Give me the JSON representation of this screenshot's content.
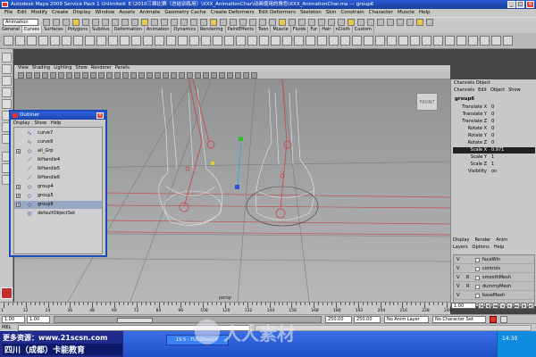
{
  "window": {
    "title": "Autodesk Maya 2009 Service Pack 1  Unlimited: E:\\2010三维比赛（总结训练用）\\XXX_AnimationChar\\动画使用的角色\\XXX_AnimationChar.ma  ---  group6",
    "min": "_",
    "max": "□",
    "close": "×"
  },
  "menubar": [
    "File",
    "Edit",
    "Modify",
    "Create",
    "Display",
    "Window",
    "Assets",
    "Animate",
    "Geometry Cache",
    "Create Deformers",
    "Edit Deformers",
    "Skeleton",
    "Skin",
    "Constrain",
    "Character",
    "Muscle",
    "Help"
  ],
  "statusline": {
    "mode": "Animation"
  },
  "shelf_tabs": [
    "General",
    "Curves",
    "Surfaces",
    "Polygons",
    "Subdivs",
    "Deformation",
    "Animation",
    "Dynamics",
    "Rendering",
    "PaintEffects",
    "Toon",
    "Muscle",
    "Fluids",
    "Fur",
    "Hair",
    "nCloth",
    "Custom"
  ],
  "shelf_active": 1,
  "viewport": {
    "menu": [
      "View",
      "Shading",
      "Lighting",
      "Show",
      "Renderer",
      "Panels"
    ],
    "camera_label": "persp",
    "viewcube_label": "FRONT"
  },
  "outliner": {
    "title": "Outliner",
    "menu": [
      "Display",
      "Show",
      "Help"
    ],
    "items": [
      {
        "label": "curve7",
        "icon": "curve-icon",
        "expand": ""
      },
      {
        "label": "curve9",
        "icon": "curve-icon",
        "expand": ""
      },
      {
        "label": "ali_Grp",
        "icon": "group-icon",
        "expand": "+"
      },
      {
        "label": "ikHandle4",
        "icon": "ikhandle-icon",
        "expand": ""
      },
      {
        "label": "ikHandle5",
        "icon": "ikhandle-icon",
        "expand": ""
      },
      {
        "label": "ikHandle6",
        "icon": "ikhandle-icon",
        "expand": ""
      },
      {
        "label": "group4",
        "icon": "group-icon",
        "expand": "+"
      },
      {
        "label": "group5",
        "icon": "group-icon",
        "expand": "+"
      },
      {
        "label": "group6",
        "icon": "group-icon",
        "expand": "+"
      },
      {
        "label": "defaultObjectSet",
        "icon": "set-icon",
        "expand": ""
      }
    ],
    "selected_index": 8
  },
  "channel_box": {
    "header": "Channels  Object",
    "menu": [
      "Channels",
      "Edit",
      "Object",
      "Show"
    ],
    "object": "group6",
    "channels": [
      {
        "name": "Translate X",
        "value": "0"
      },
      {
        "name": "Translate Y",
        "value": "0"
      },
      {
        "name": "Translate Z",
        "value": "0"
      },
      {
        "name": "Rotate X",
        "value": "0"
      },
      {
        "name": "Rotate Y",
        "value": "0"
      },
      {
        "name": "Rotate Z",
        "value": "0"
      },
      {
        "name": "Scale X",
        "value": "0.971"
      },
      {
        "name": "Scale Y",
        "value": "1"
      },
      {
        "name": "Scale Z",
        "value": "1"
      },
      {
        "name": "Visibility",
        "value": "on"
      }
    ],
    "highlight_index": 6,
    "layer_tabs": [
      "Display",
      "Render",
      "Anim"
    ],
    "layer_menu": [
      "Layers",
      "Options",
      "Help"
    ],
    "layers": [
      {
        "v": "V",
        "r": "",
        "name": "faceWin"
      },
      {
        "v": "V",
        "r": "",
        "name": "controls"
      },
      {
        "v": "V",
        "r": "R",
        "name": "smoothMesh"
      },
      {
        "v": "V",
        "r": "R",
        "name": "dummyMesh"
      },
      {
        "v": "V",
        "r": "",
        "name": "baseMesh"
      }
    ]
  },
  "timeslider": {
    "ticks": [
      "1",
      "12",
      "24",
      "36",
      "48",
      "60",
      "72",
      "84",
      "96",
      "108",
      "120",
      "132",
      "144",
      "156",
      "168",
      "180",
      "192",
      "204",
      "216",
      "228",
      "240"
    ],
    "current_frame": "1.00"
  },
  "rangebar": {
    "start": "1.00",
    "inner_start": "1.00",
    "inner_end": "250.00",
    "end": "250.00",
    "anim_layer": "No Anim Layer",
    "char_set": "No Character Set"
  },
  "cmdline": {
    "label": "MEL"
  },
  "taskbar": {
    "brand_line1": "更多资源：www.21scsn.com",
    "brand_line2": "四川（成都）卡能教育",
    "task_button": "19.5 - TUGZhaxGIF",
    "watermark": "人人素材",
    "clock": "14:30"
  },
  "colors": {
    "titlebar": "#2a5bd7",
    "viewport_bg": "#9a9b9d",
    "selection": "#98a7c4",
    "joint_red": "#c0392b"
  }
}
